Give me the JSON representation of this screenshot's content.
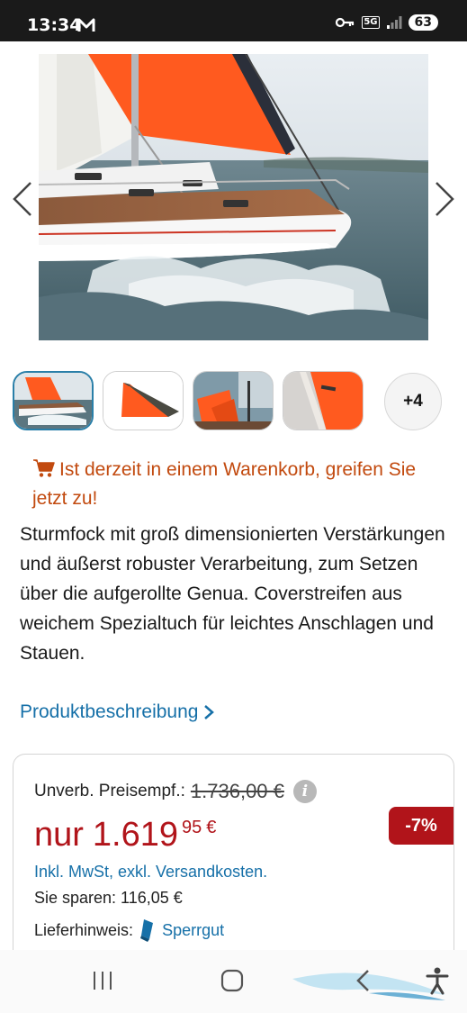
{
  "status_bar": {
    "time": "13:34",
    "network": "5G",
    "battery": "63"
  },
  "gallery": {
    "prev_icon": "chevron-left-icon",
    "next_icon": "chevron-right-icon",
    "more_count": "+4"
  },
  "cart_notice": {
    "icon": "cart-icon",
    "text": "Ist derzeit in einem Warenkorb, greifen Sie jetzt zu!"
  },
  "description": {
    "text": "Sturmfock mit groß dimensionierten Verstärkungen und äußerst robuster Verarbeitung, zum Setzen über die aufgerollte Genua. Coverstreifen aus weichem Spezialtuch für leichtes Anschlagen und Stauen.",
    "link_label": "Produktbeschreibung"
  },
  "price": {
    "rrp_label": "Unverb. Preisempf.:",
    "rrp_value": "1.736,00 €",
    "prefix": "nur",
    "main": "1.619",
    "cents": "95",
    "currency": "€",
    "discount": "-7%",
    "tax_note": "Inkl. MwSt, exkl. Versandkosten.",
    "savings": "Sie sparen: 116,05 €",
    "shipping_label": "Lieferhinweis:",
    "shipping_value": "Sperrgut"
  },
  "colors": {
    "accent_orange": "#c24a0f",
    "price_red": "#b1141a",
    "link_blue": "#1670a8",
    "sail_orange": "#ff5a1f"
  }
}
